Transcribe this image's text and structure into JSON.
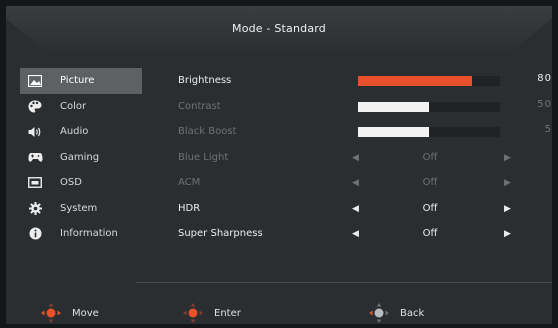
{
  "header": {
    "title": "Mode - Standard"
  },
  "sidebar": {
    "items": [
      {
        "label": "Picture",
        "icon": "picture-icon",
        "active": true
      },
      {
        "label": "Color",
        "icon": "palette-icon",
        "active": false
      },
      {
        "label": "Audio",
        "icon": "speaker-icon",
        "active": false
      },
      {
        "label": "Gaming",
        "icon": "gamepad-icon",
        "active": false
      },
      {
        "label": "OSD",
        "icon": "osd-window-icon",
        "active": false
      },
      {
        "label": "System",
        "icon": "gear-icon",
        "active": false
      },
      {
        "label": "Information",
        "icon": "info-icon",
        "active": false
      }
    ]
  },
  "settings": [
    {
      "label": "Brightness",
      "type": "slider",
      "value": "80",
      "level": 0.8,
      "enabled": true,
      "fill_color": "#e8512a"
    },
    {
      "label": "Contrast",
      "type": "slider",
      "value": "50",
      "level": 0.5,
      "enabled": false,
      "fill_color": "#f2f2f2"
    },
    {
      "label": "Black Boost",
      "type": "slider",
      "value": "5",
      "level": 0.5,
      "enabled": false,
      "fill_color": "#f2f2f2"
    },
    {
      "label": "Blue Light",
      "type": "option",
      "value": "Off",
      "enabled": false
    },
    {
      "label": "ACM",
      "type": "option",
      "value": "Off",
      "enabled": false
    },
    {
      "label": "HDR",
      "type": "option",
      "value": "Off",
      "enabled": true
    },
    {
      "label": "Super Sharpness",
      "type": "option",
      "value": "Off",
      "enabled": true
    }
  ],
  "footer": {
    "move_label": "Move",
    "enter_label": "Enter",
    "back_label": "Back",
    "nav_icon_color": "#e8512a"
  }
}
